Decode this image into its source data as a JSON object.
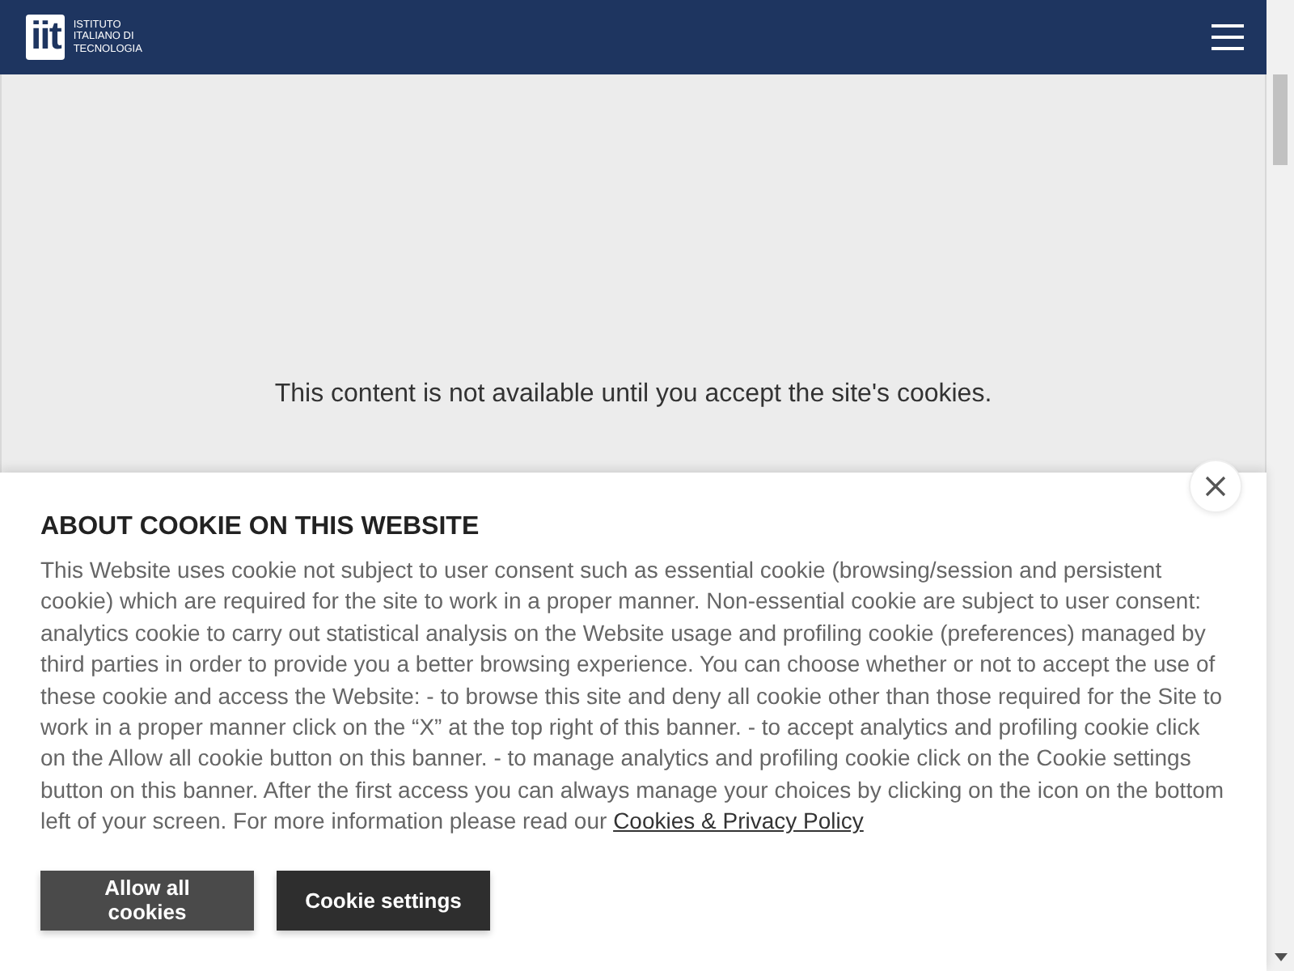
{
  "header": {
    "logo_mark": "iit",
    "logo_lines": [
      "ISTITUTO",
      "ITALIANO DI",
      "TECNOLOGIA"
    ]
  },
  "placeholder_message": "This content is not available until you accept the site's cookies.",
  "cookie_banner": {
    "title": "ABOUT COOKIE ON THIS WEBSITE",
    "body": "This Website uses cookie not subject to user consent such as essential cookie (browsing/session and persistent cookie) which are required for the site to work in a proper manner. Non-essential cookie are subject to user consent: analytics cookie to carry out statistical analysis on the Website usage and profiling cookie (preferences) managed by third parties in order to provide you a better browsing experience. You can choose whether or not to accept the use of these cookie and access the Website: - to browse this site and deny all cookie other than those required for the Site to work in a proper manner click on the “X” at the top right of this banner. - to accept analytics and profiling cookie click on the Allow all cookie button on this banner. - to manage analytics and profiling cookie click on the Cookie settings button on this banner. After the first access you can always manage your choices by clicking on the icon on the bottom left of your screen. For more information please read our ",
    "link": "Cookies & Privacy Policy",
    "buttons": [
      {
        "label": "Allow all cookies",
        "kind": "primary"
      },
      {
        "label": "Cookie settings",
        "kind": "secondary"
      }
    ]
  }
}
